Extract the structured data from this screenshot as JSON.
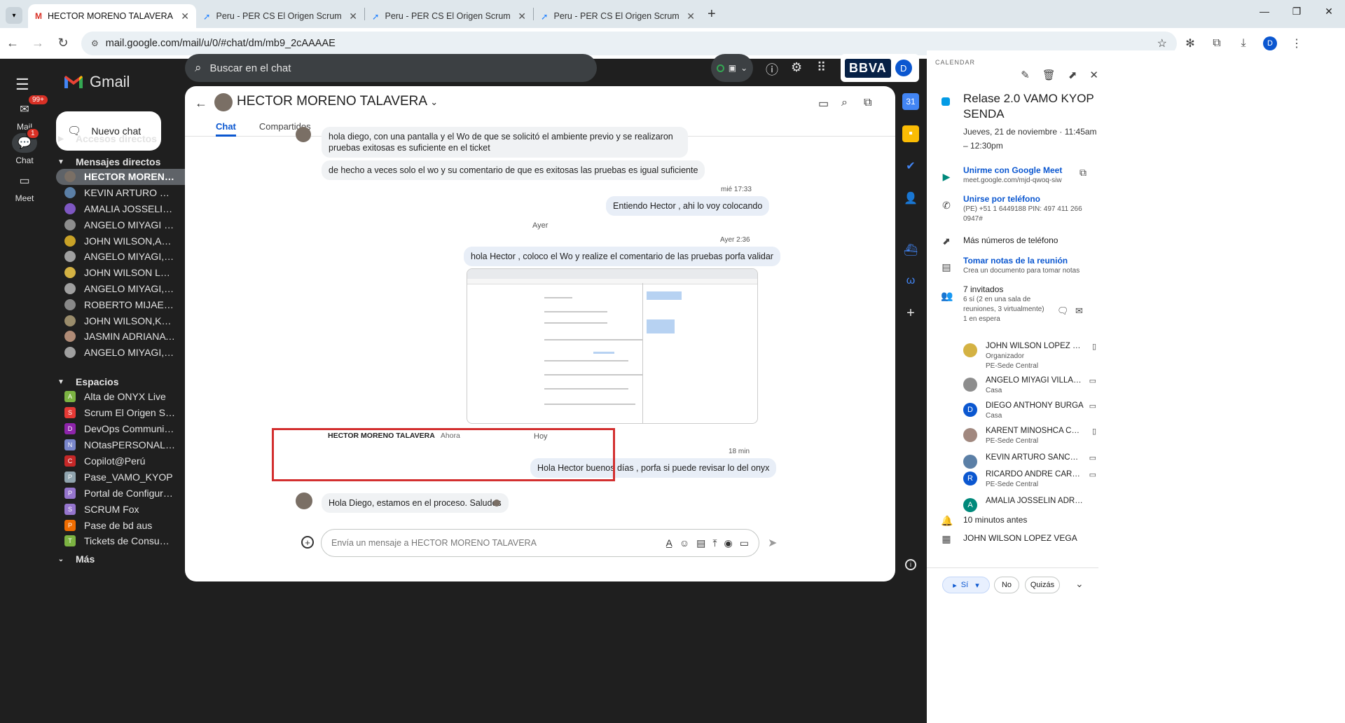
{
  "browser": {
    "tabs": [
      {
        "title": "HECTOR MORENO TALAVERA -",
        "active": true
      },
      {
        "title": "Peru - PER CS El Origen Scrum",
        "active": false
      },
      {
        "title": "Peru - PER CS El Origen Scrum",
        "active": false
      },
      {
        "title": "Peru - PER CS El Origen Scrum",
        "active": false
      }
    ],
    "url": "mail.google.com/mail/u/0/#chat/dm/mb9_2cAAAAE",
    "profile_initial": "D"
  },
  "rail": {
    "mail_label": "Mail",
    "mail_badge": "99+",
    "chat_label": "Chat",
    "chat_badge": "1",
    "meet_label": "Meet"
  },
  "nav": {
    "app_name": "Gmail",
    "compose_label": "Nuevo chat",
    "shortcuts_label": "Accesos directos",
    "dm_label": "Mensajes directos",
    "dm_count": "1",
    "dms": [
      {
        "name": "HECTOR MORENO TALAVERA",
        "selected": true,
        "color": "#7a6f65"
      },
      {
        "name": "KEVIN ARTURO SÁNCHEZ",
        "color": "#5b7fa6"
      },
      {
        "name": "AMALIA JOSSELIN ADRIA",
        "color": "#7e57c2"
      },
      {
        "name": "ANGELO MIYAGI VILLA",
        "color": "#8d8d8d"
      },
      {
        "name": "JOHN WILSON,AMALIA",
        "color": "#c9a227"
      },
      {
        "name": "ANGELO MIYAGI,JOHN",
        "color": "#a0a0a0"
      },
      {
        "name": "JOHN WILSON LOPEZ VEGA",
        "color": "#d4b243"
      },
      {
        "name": "ANGELO MIYAGI,JOHN",
        "color": "#a0a0a0"
      },
      {
        "name": "ROBERTO MIJAEL BUSTOS",
        "color": "#888"
      },
      {
        "name": "JOHN WILSON,KEVIN",
        "color": "#9a8c6b"
      },
      {
        "name": "JASMIN ADRIANA SALAS",
        "color": "#b08b76"
      },
      {
        "name": "ANGELO MIYAGI,JOHN",
        "color": "#a0a0a0"
      }
    ],
    "spaces_label": "Espacios",
    "spaces": [
      {
        "name": "Alta de ONYX Live",
        "icon": "A",
        "color": "#7cb342"
      },
      {
        "name": "Scrum El Origen Sendero",
        "icon": "S",
        "color": "#e53935"
      },
      {
        "name": "DevOps Community Peru",
        "icon": "D",
        "color": "#8e24aa"
      },
      {
        "name": "NOtasPERSONALES",
        "icon": "N",
        "color": "#7986cb"
      },
      {
        "name": "Copilot@Perú",
        "icon": "C",
        "color": "#c62828"
      },
      {
        "name": "Pase_VAMO_KYOP",
        "icon": "P",
        "color": "#90a4ae"
      },
      {
        "name": "Portal de Configuración",
        "icon": "P",
        "color": "#9575cd"
      },
      {
        "name": "SCRUM Fox",
        "icon": "S",
        "color": "#9575cd"
      },
      {
        "name": "Pase de bd aus",
        "icon": "P",
        "color": "#ef6c00"
      },
      {
        "name": "Tickets de Consumo ONYX",
        "icon": "T",
        "color": "#7cb342"
      }
    ],
    "more_label": "Más"
  },
  "topbar": {
    "search_placeholder": "Buscar en el chat",
    "brand": "BBVA",
    "avatar_initial": "D"
  },
  "chat": {
    "contact_name": "HECTOR MORENO TALAVERA",
    "tabs": [
      "Chat",
      "Compartidos"
    ],
    "messages": {
      "m1": "hola diego, con una pantalla y el Wo de que se solicitó el ambiente previo y se realizaron pruebas exitosas es suficiente en el ticket",
      "m2": "de hecho a veces solo el wo y su comentario de que es exitosas las pruebas es igual suficiente",
      "m3_time": "mié 17:33",
      "m3": "Entiendo Hector , ahi lo voy colocando",
      "day_ayer": "Ayer",
      "m4_time": "Ayer 2:36",
      "m4": "hola Hector , coloco el Wo y realize el comentario de las pruebas porfa validar",
      "day_hoy": "Hoy",
      "m5_time": "18 min",
      "m5": "Hola Hector buenos días , porfa si puede revisar lo del onyx",
      "m6_sender": "HECTOR MORENO TALAVERA",
      "m6_time": "Ahora",
      "m6": "Hola Diego, estamos en el proceso. Saludos"
    },
    "composer_placeholder": "Envía un mensaje a HECTOR MORENO TALAVERA"
  },
  "calendar": {
    "label": "CALENDAR",
    "title": "Relase 2.0 VAMO KYOP SENDA",
    "date": "Jueves, 21 de noviembre · 11:45am – 12:30pm",
    "meet_label": "Unirme con Google Meet",
    "meet_url": "meet.google.com/mjd-qwoq-siw",
    "phone_label": "Unirse por teléfono",
    "phone_detail": "(PE) +51 1 6449188 PIN: 497 411 266 0947#",
    "more_phones": "Más números de teléfono",
    "notes_label": "Tomar notas de la reunión",
    "notes_sub": "Crea un documento para tomar notas",
    "guests_count": "7 invitados",
    "guests_detail": "6 sí (2 en una sala de reuniones, 3 virtualmente)",
    "guests_waiting": "1 en espera",
    "guests": [
      {
        "name": "JOHN WILSON LOPEZ VEGA",
        "role": "Organizador",
        "loc": "PE-Sede Central",
        "initial": "",
        "color": "#d4b243"
      },
      {
        "name": "ANGELO MIYAGI VILLANUEVA",
        "role": "Casa",
        "loc": "",
        "initial": "",
        "color": "#8d8d8d"
      },
      {
        "name": "DIEGO ANTHONY BURGA",
        "role": "Casa",
        "loc": "",
        "initial": "D",
        "color": "#0b57d0"
      },
      {
        "name": "KARENT MINOSHCA CASTRO",
        "role": "PE-Sede Central",
        "loc": "",
        "initial": "",
        "color": "#a1887f"
      },
      {
        "name": "KEVIN ARTURO SÁNCHEZ",
        "role": "",
        "loc": "",
        "initial": "",
        "color": "#5b7fa6"
      },
      {
        "name": "RICARDO ANDRE CARBAJAL",
        "role": "PE-Sede Central",
        "loc": "",
        "initial": "R",
        "color": "#0b57d0"
      },
      {
        "name": "AMALIA JOSSELIN ADRIANZEN",
        "role": "",
        "loc": "",
        "initial": "A",
        "color": "#00897b"
      }
    ],
    "reminder": "10 minutos antes",
    "organizer": "JOHN WILSON LOPEZ VEGA",
    "rsvp_yes": "Sí",
    "rsvp_no": "No",
    "rsvp_maybe": "Quizás"
  }
}
